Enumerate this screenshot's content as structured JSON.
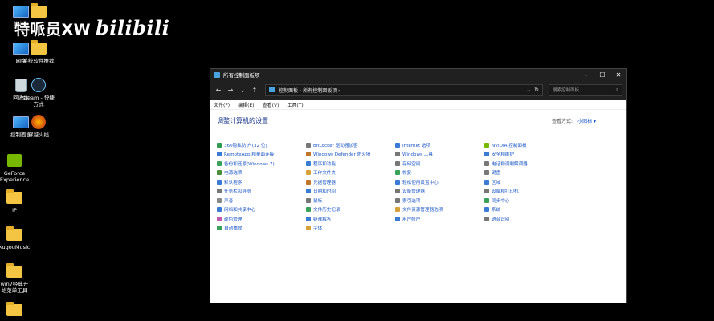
{
  "desktop": {
    "icons": [
      {
        "label": "此电脑",
        "type": "monitor"
      },
      {
        "label": "",
        "type": "folder"
      },
      {
        "label": "网络",
        "type": "monitor"
      },
      {
        "label": "系统软件推荐",
        "type": "folder"
      },
      {
        "label": "回收站",
        "type": "recycle"
      },
      {
        "label": "steam - 快捷\n方式",
        "type": "steam"
      },
      {
        "label": "控制面板",
        "type": "monitor"
      },
      {
        "label": "穿越火线",
        "type": "cf"
      },
      {
        "label": "GeForce\nExperience",
        "type": "nvidia"
      },
      {
        "label": "IP",
        "type": "folder"
      },
      {
        "label": "KugouMusic",
        "type": "folder"
      },
      {
        "label": "win7经典开\n始菜单工具",
        "type": "folder"
      },
      {
        "label": "",
        "type": "folder"
      }
    ],
    "watermark": "特哌员XW",
    "watermark_brand": "bilibili"
  },
  "window": {
    "title": "所有控制面板项",
    "address": "控制面板  ›  所有控制面板项  ›",
    "search_placeholder": "搜索控制面板",
    "menus": [
      "文件(F)",
      "编辑(E)",
      "查看(V)",
      "工具(T)"
    ],
    "heading": "调整计算机的设置",
    "view_by_label": "查看方式:",
    "view_by_value": "小图标 ▾",
    "columns": [
      [
        {
          "label": "360隐私防护 (32 位)",
          "color": "#2e9b4f"
        },
        {
          "label": "RemoteApp 和桌面连接",
          "color": "#3a7bd5"
        },
        {
          "label": "备份和还原(Windows 7)",
          "color": "#3aa15b"
        },
        {
          "label": "电源选项",
          "color": "#4b8f3a"
        },
        {
          "label": "默认程序",
          "color": "#3a7bd5"
        },
        {
          "label": "任务栏和导航",
          "color": "#777777"
        },
        {
          "label": "声音",
          "color": "#888888"
        },
        {
          "label": "网络和共享中心",
          "color": "#3a7bd5"
        },
        {
          "label": "颜色管理",
          "color": "#c05ab0"
        },
        {
          "label": "自动播放",
          "color": "#3aa15b"
        }
      ],
      [
        {
          "label": "BitLocker 驱动器加密",
          "color": "#777777"
        },
        {
          "label": "Windows Defender 防火墙",
          "color": "#c0772a"
        },
        {
          "label": "程序和功能",
          "color": "#3a7bd5"
        },
        {
          "label": "工作文件夹",
          "color": "#d6a13a"
        },
        {
          "label": "凭据管理器",
          "color": "#c0772a"
        },
        {
          "label": "日期和时间",
          "color": "#3a7bd5"
        },
        {
          "label": "鼠标",
          "color": "#777777"
        },
        {
          "label": "文件历史记录",
          "color": "#3aa15b"
        },
        {
          "label": "疑难解答",
          "color": "#3a7bd5"
        },
        {
          "label": "字体",
          "color": "#d6a13a"
        }
      ],
      [
        {
          "label": "Internet 选项",
          "color": "#3a7bd5"
        },
        {
          "label": "Windows 工具",
          "color": "#777777"
        },
        {
          "label": "存储空间",
          "color": "#777777"
        },
        {
          "label": "恢复",
          "color": "#3aa15b"
        },
        {
          "label": "轻松使用设置中心",
          "color": "#3a7bd5"
        },
        {
          "label": "设备管理器",
          "color": "#777777"
        },
        {
          "label": "索引选项",
          "color": "#777777"
        },
        {
          "label": "文件资源管理器选项",
          "color": "#d6a13a"
        },
        {
          "label": "用户帐户",
          "color": "#3a7bd5"
        }
      ],
      [
        {
          "label": "NVIDIA 控制面板",
          "color": "#76b900"
        },
        {
          "label": "安全和维护",
          "color": "#3a7bd5"
        },
        {
          "label": "电话和调制解调器",
          "color": "#777777"
        },
        {
          "label": "键盘",
          "color": "#777777"
        },
        {
          "label": "区域",
          "color": "#3a7bd5"
        },
        {
          "label": "设备和打印机",
          "color": "#777777"
        },
        {
          "label": "同步中心",
          "color": "#3aa15b"
        },
        {
          "label": "系统",
          "color": "#3a7bd5"
        },
        {
          "label": "语音识别",
          "color": "#777777"
        }
      ]
    ]
  }
}
